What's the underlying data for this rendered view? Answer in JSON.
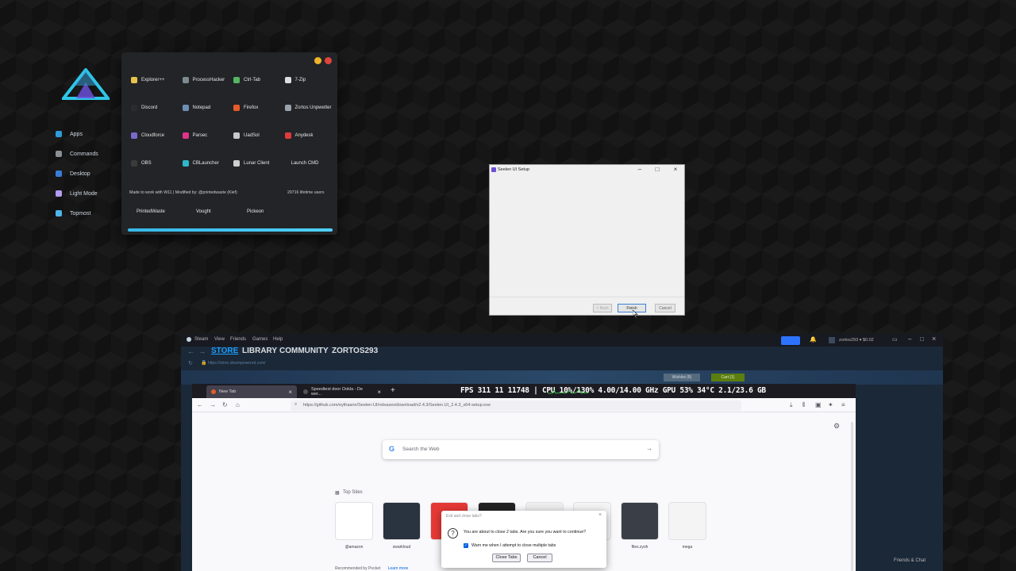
{
  "launcher": {
    "menu": [
      {
        "label": "Apps",
        "icon": "apps-icon",
        "color": "#2f9bd9"
      },
      {
        "label": "Commands",
        "icon": "commands-icon",
        "color": "#8a8f96"
      },
      {
        "label": "Desktop",
        "icon": "desktop-icon",
        "color": "#3a7bd5"
      },
      {
        "label": "Light Mode",
        "icon": "light-mode-icon",
        "color": "#b49cf0"
      },
      {
        "label": "Topmost",
        "icon": "topmost-icon",
        "color": "#4fb4e8"
      }
    ],
    "apps": [
      {
        "label": "Explorer++",
        "icon": "explorer-icon",
        "color": "#e8c34b"
      },
      {
        "label": "ProcessHacker",
        "icon": "processhacker-icon",
        "color": "#7d8a92"
      },
      {
        "label": "Ctrl-Tab",
        "icon": "ctrltab-icon",
        "color": "#55b562"
      },
      {
        "label": "7-Zip",
        "icon": "7zip-icon",
        "color": "#dddddd"
      },
      {
        "label": "Discord",
        "icon": "discord-icon",
        "color": "#2b2b2b"
      },
      {
        "label": "Notepad",
        "icon": "notepad-icon",
        "color": "#6d8fb5"
      },
      {
        "label": "Firefox",
        "icon": "firefox-icon",
        "color": "#e55b2a"
      },
      {
        "label": "Zortos Unpwetter",
        "icon": "zortos-icon",
        "color": "#9aa3ab"
      },
      {
        "label": "Cloudforce",
        "icon": "cloudforce-icon",
        "color": "#7b68c9"
      },
      {
        "label": "Parsec",
        "icon": "parsec-icon",
        "color": "#e0338a"
      },
      {
        "label": "UadSol",
        "icon": "uadsol-icon",
        "color": "#c9c9c9"
      },
      {
        "label": "Anydesk",
        "icon": "anydesk-icon",
        "color": "#e03b3b"
      },
      {
        "label": "OBS",
        "icon": "obs-icon",
        "color": "#3a3a3a"
      },
      {
        "label": "CBLauncher",
        "icon": "cblauncher-icon",
        "color": "#2fb6c9"
      },
      {
        "label": "Lunar Client",
        "icon": "lunar-icon",
        "color": "#cfcfcf"
      },
      {
        "label": "Launch CMD",
        "icon": "",
        "color": ""
      }
    ],
    "info": "Made to work with W11 | Modified by: @printedwaste (Kief)",
    "users": "29716 lifetime users",
    "credits": [
      "PrintedWaste",
      "Vought",
      "Pickeon"
    ]
  },
  "setup": {
    "title": "Seelen UI Setup",
    "back": "< Back",
    "finish": "Finish",
    "cancel": "Cancel"
  },
  "steam": {
    "menu": [
      "Steam",
      "View",
      "Friends",
      "Games",
      "Help"
    ],
    "nav": [
      "STORE",
      "LIBRARY",
      "COMMUNITY",
      "ZORTOS293"
    ],
    "url": "https://store.steampowered.com/",
    "wishlist": "Wishlist (8)",
    "cart": "Cart (1)",
    "account": "zortos293 ▾ $0.02",
    "friends_chat": "Friends & Chat"
  },
  "browser": {
    "tabs": [
      "New Tab",
      "Speedtest door Ookla - De wer..."
    ],
    "new_tab": "+",
    "overlay": "FPS 311 11 11748 | CPU 10%/130% 4.00/14.00 GHz GPU 53% 34°C 2.1/23.6 GB",
    "url": "https://github.com/eythaann/Seelen-UI/releases/download/v2.4.3/Seelen.UI_2.4.3_x64-setup.exe",
    "search_placeholder": "Search the Web",
    "top_sites_label": "Top Sites",
    "sites": [
      {
        "label": "@amazon",
        "color": "#ffffff"
      },
      {
        "label": "swarkloud",
        "color": "#2a3340"
      },
      {
        "label": "",
        "color": "#e53935"
      },
      {
        "label": "",
        "color": "#222222"
      },
      {
        "label": "",
        "color": "#eeeeee"
      },
      {
        "label": "",
        "color": "#f4f4f4"
      },
      {
        "label": "files.zyoh",
        "color": "#3a3f47"
      },
      {
        "label": "mega",
        "color": "#f4f4f4"
      }
    ],
    "recommended": "Recommended by Pocket",
    "learn_more": "Learn more"
  },
  "close_dialog": {
    "title": "Exit and close tabs?",
    "message": "You are about to close 2 tabs. Are you sure you want to continue?",
    "warn": "Warn me when I attempt to close multiple tabs",
    "close_tabs": "Close Tabs",
    "cancel": "Cancel"
  }
}
